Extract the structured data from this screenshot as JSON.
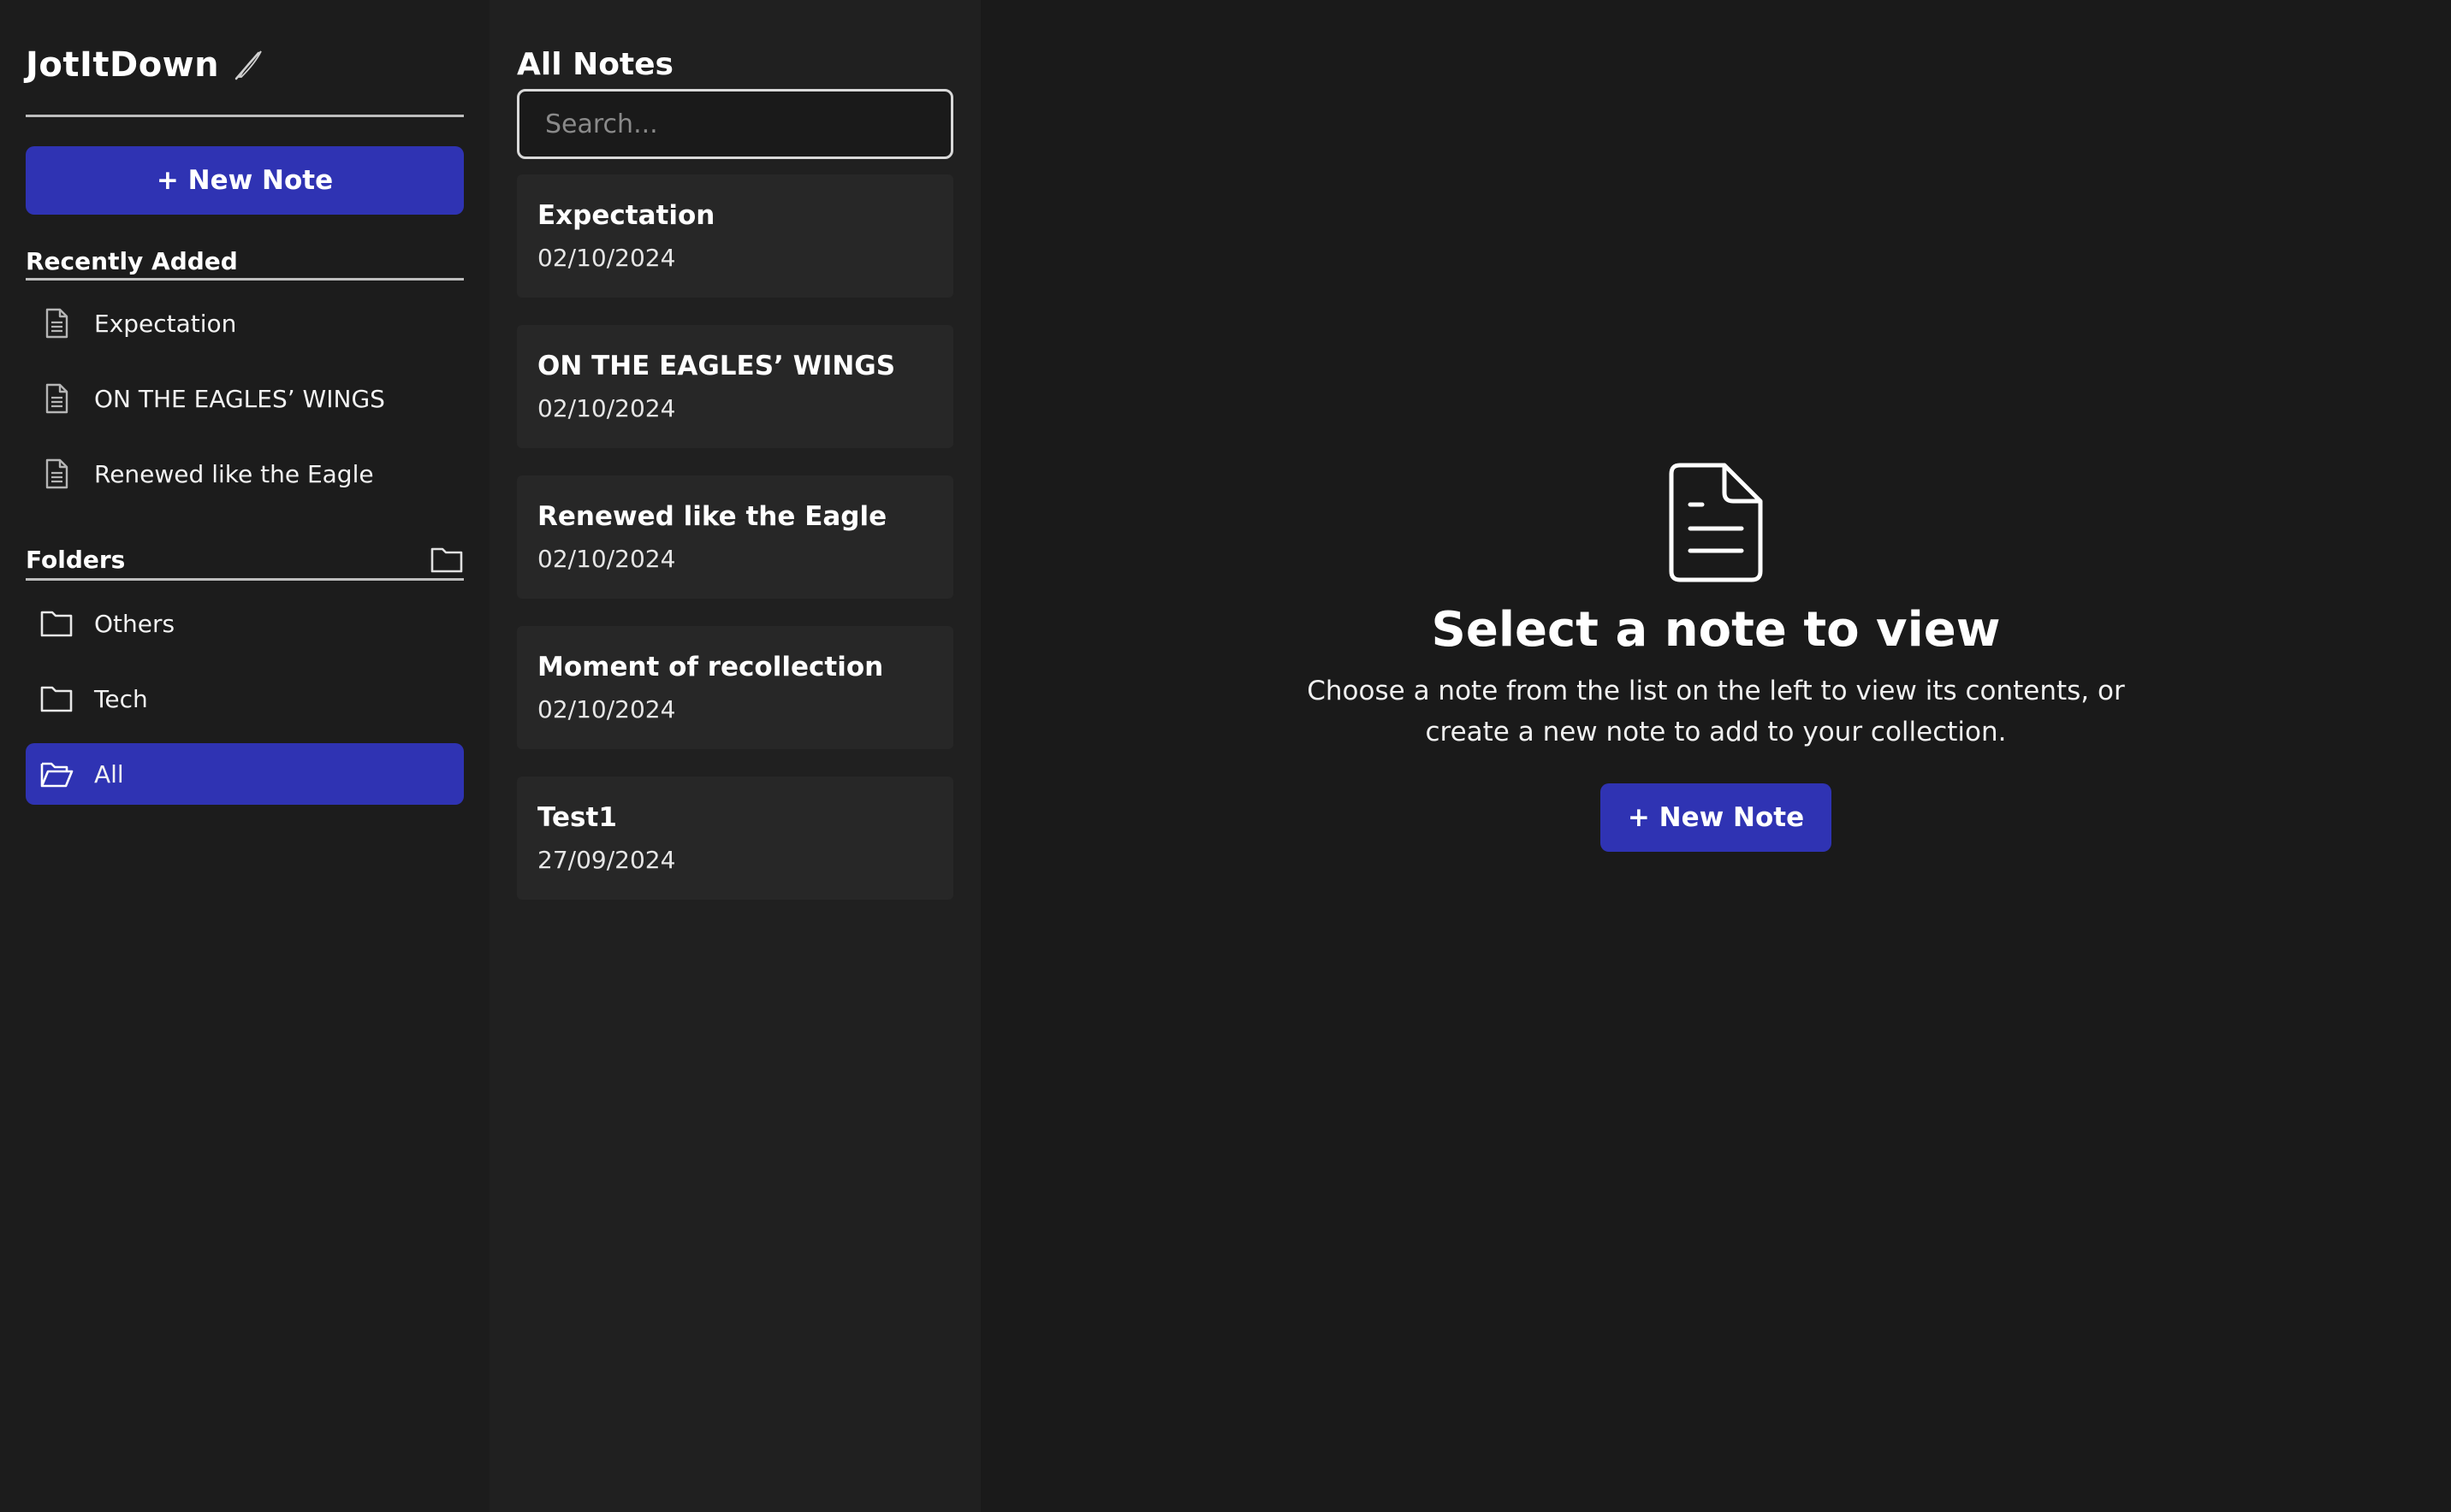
{
  "app": {
    "title": "JotItDown",
    "title_icon": "quill-pen-icon"
  },
  "sidebar": {
    "new_note_label": "+ New Note",
    "recently_added": {
      "title": "Recently Added",
      "items": [
        {
          "label": "Expectation",
          "icon": "document-icon"
        },
        {
          "label": "ON THE EAGLES’ WINGS",
          "icon": "document-icon"
        },
        {
          "label": "Renewed like the Eagle",
          "icon": "document-icon"
        }
      ]
    },
    "folders": {
      "title": "Folders",
      "add_icon": "folder-add-icon",
      "items": [
        {
          "label": "Others",
          "icon": "folder-icon",
          "active": false
        },
        {
          "label": "Tech",
          "icon": "folder-icon",
          "active": false
        },
        {
          "label": "All",
          "icon": "folder-open-icon",
          "active": true
        }
      ]
    }
  },
  "notes": {
    "title": "All Notes",
    "search_placeholder": "Search...",
    "items": [
      {
        "title": "Expectation",
        "date": "02/10/2024"
      },
      {
        "title": "ON THE EAGLES’ WINGS",
        "date": "02/10/2024"
      },
      {
        "title": "Renewed like the Eagle",
        "date": "02/10/2024"
      },
      {
        "title": "Moment of recollection",
        "date": "02/10/2024"
      },
      {
        "title": "Test1",
        "date": "27/09/2024"
      }
    ]
  },
  "main": {
    "icon": "document-icon",
    "title": "Select a note to view",
    "description": "Choose a note from the list on the left to view its contents, or create a new note to add to your collection.",
    "new_note_label": "+ New Note"
  },
  "colors": {
    "accent": "#2f33b3",
    "sidebar_bg": "#1c1c1c",
    "list_bg": "#202020",
    "card_bg": "#272727",
    "main_bg": "#1a1a1a"
  }
}
